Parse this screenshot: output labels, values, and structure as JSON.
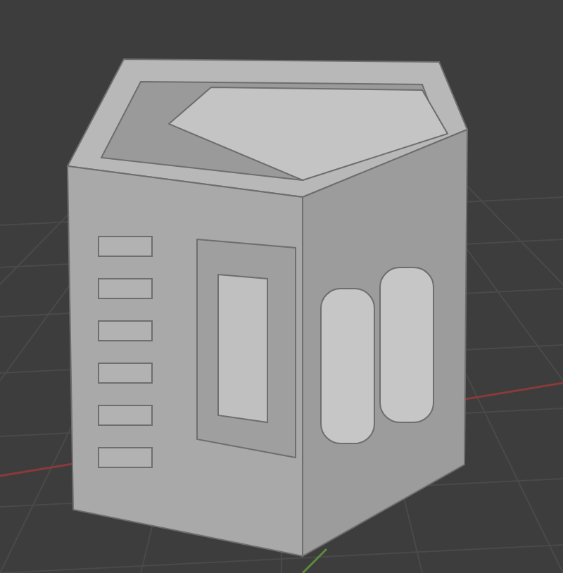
{
  "viewport": {
    "kind": "perspective"
  }
}
